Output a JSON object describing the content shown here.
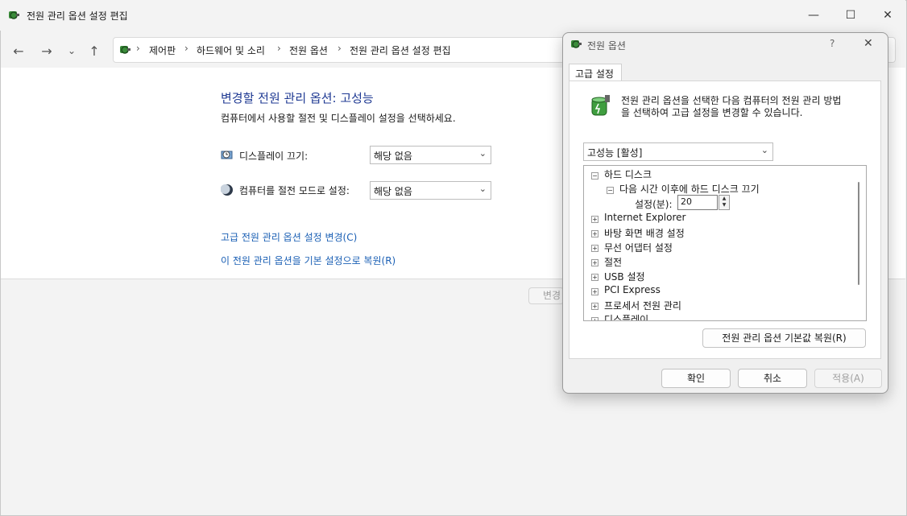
{
  "main": {
    "title": "전원 관리 옵션 설정 편집",
    "controls": {
      "minimize": "—",
      "maximize": "☐",
      "close": "✕"
    },
    "nav": {
      "back": "←",
      "forward": "→",
      "dropdown": "⌄",
      "up": "↑"
    },
    "breadcrumb": [
      "제어판",
      "하드웨어 및 소리",
      "전원 옵션",
      "전원 관리 옵션 설정 편집"
    ],
    "page_title": "변경할 전원 관리 옵션: 고성능",
    "page_subtitle": "컴퓨터에서 사용할 절전 및 디스플레이 설정을 선택하세요.",
    "settings": [
      {
        "label": "디스플레이 끄기:",
        "value": "해당 없음",
        "icon": "monitor-clock-icon"
      },
      {
        "label": "컴퓨터를 절전 모드로 설정:",
        "value": "해당 없음",
        "icon": "moon-icon"
      }
    ],
    "links": {
      "advanced": "고급 전원 관리 옵션 설정 변경(C)",
      "restore": "이 전원 관리 옵션을 기본 설정으로 복원(R)"
    },
    "save_partial": "변경"
  },
  "dialog": {
    "title": "전원 옵션",
    "help": "?",
    "close": "✕",
    "tab": "고급 설정",
    "description": "전원 관리 옵션을 선택한 다음 컴퓨터의 전원 관리 방법\n을 선택하여 고급 설정을 변경할 수 있습니다.",
    "plan": "고성능 [활성]",
    "tree": {
      "hard_disk": "하드 디스크",
      "turn_off_after": "다음 시간 이후에 하드 디스크 끄기",
      "setting_label": "설정(분):",
      "setting_value": "20",
      "items": [
        "Internet Explorer",
        "바탕 화면 배경 설정",
        "무선 어댑터 설정",
        "절전",
        "USB 설정",
        "PCI Express",
        "프로세서 전원 관리",
        "디스플레이"
      ]
    },
    "restore_button": "전원 관리 옵션 기본값 복원(R)",
    "ok": "확인",
    "cancel": "취소",
    "apply": "적용(A)"
  },
  "colors": {
    "link": "#1a5fb4",
    "title": "#1f3a93",
    "window_bg": "#f3f3f3"
  }
}
